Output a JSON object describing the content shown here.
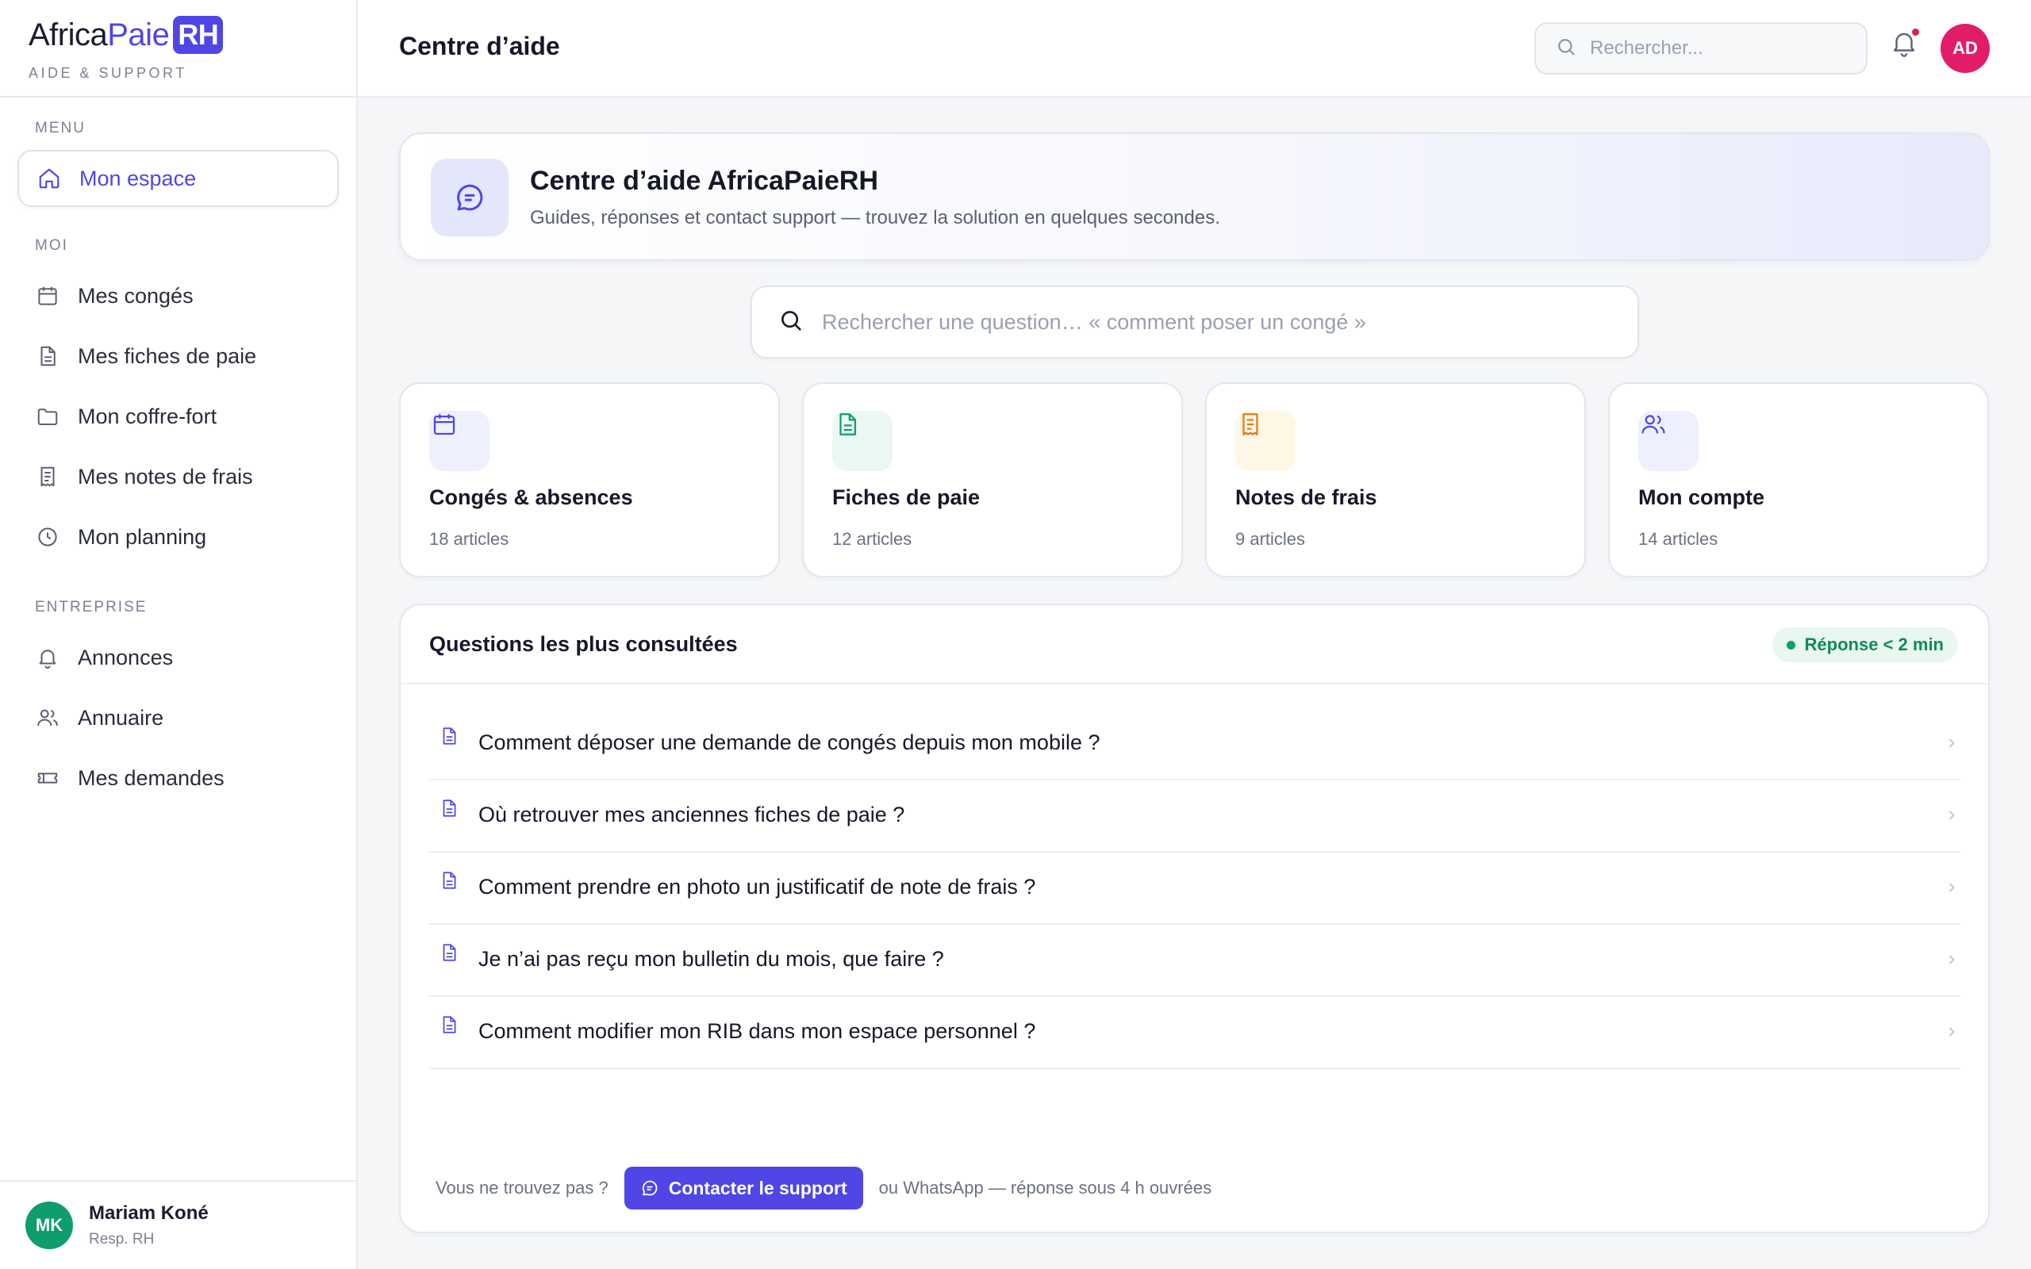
{
  "brand": {
    "logo_part1": "Africa",
    "logo_part2": "Paie",
    "logo_part3": "RH",
    "tagline": "AIDE & SUPPORT"
  },
  "sidebar": {
    "sections": {
      "menu": "MENU",
      "moi": "MOI",
      "entreprise": "ENTREPRISE"
    },
    "home": {
      "label": "Mon espace",
      "icon": "home-icon"
    },
    "moi_items": [
      {
        "label": "Mes congés",
        "icon": "calendar-icon"
      },
      {
        "label": "Mes fiches de paie",
        "icon": "document-icon"
      },
      {
        "label": "Mon coffre-fort",
        "icon": "folder-icon"
      },
      {
        "label": "Mes notes de frais",
        "icon": "receipt-icon"
      },
      {
        "label": "Mon planning",
        "icon": "clock-icon"
      }
    ],
    "entreprise_items": [
      {
        "label": "Annonces",
        "icon": "bell-icon"
      },
      {
        "label": "Annuaire",
        "icon": "users-icon"
      },
      {
        "label": "Mes demandes",
        "icon": "ticket-icon"
      }
    ],
    "user": {
      "initials": "MK",
      "name": "Mariam Koné",
      "role": "Resp. RH"
    }
  },
  "header": {
    "title": "Centre d’aide",
    "search_placeholder": "Rechercher...",
    "avatar_initials": "AD"
  },
  "hero": {
    "title": "Centre d’aide AfricaPaieRH",
    "subtitle": "Guides, réponses et contact support — trouvez la solution en quelques secondes."
  },
  "help_search": {
    "placeholder": "Rechercher une question… « comment poser un congé »"
  },
  "categories": [
    {
      "title": "Congés & absences",
      "count": "18 articles",
      "icon": "calendar-icon",
      "color": "#4f46e5",
      "bg": "#eef0fd"
    },
    {
      "title": "Fiches de paie",
      "count": "12 articles",
      "icon": "document-icon",
      "color": "#0f9d6b",
      "bg": "#eaf8f1"
    },
    {
      "title": "Notes de frais",
      "count": "9 articles",
      "icon": "receipt-icon",
      "color": "#e07b12",
      "bg": "#fff7e6"
    },
    {
      "title": "Mon compte",
      "count": "14 articles",
      "icon": "users-icon",
      "color": "#4f46e5",
      "bg": "#eef0fd"
    }
  ],
  "faq": {
    "title": "Questions les plus consultées",
    "badge": "Réponse < 2 min",
    "questions": [
      "Comment déposer une demande de congés depuis mon mobile ?",
      "Où retrouver mes anciennes fiches de paie ?",
      "Comment prendre en photo un justificatif de note de frais ?",
      "Je n’ai pas reçu mon bulletin du mois, que faire ?",
      "Comment modifier mon RIB dans mon espace personnel ?"
    ],
    "footer_prefix": "Vous ne trouvez pas ?",
    "contact_label": "Contacter le support",
    "footer_suffix": "ou WhatsApp — réponse sous 4 h ouvrées"
  },
  "colors": {
    "accent": "#4f46e5",
    "success": "#0f9d6b",
    "alert": "#e11d48"
  }
}
